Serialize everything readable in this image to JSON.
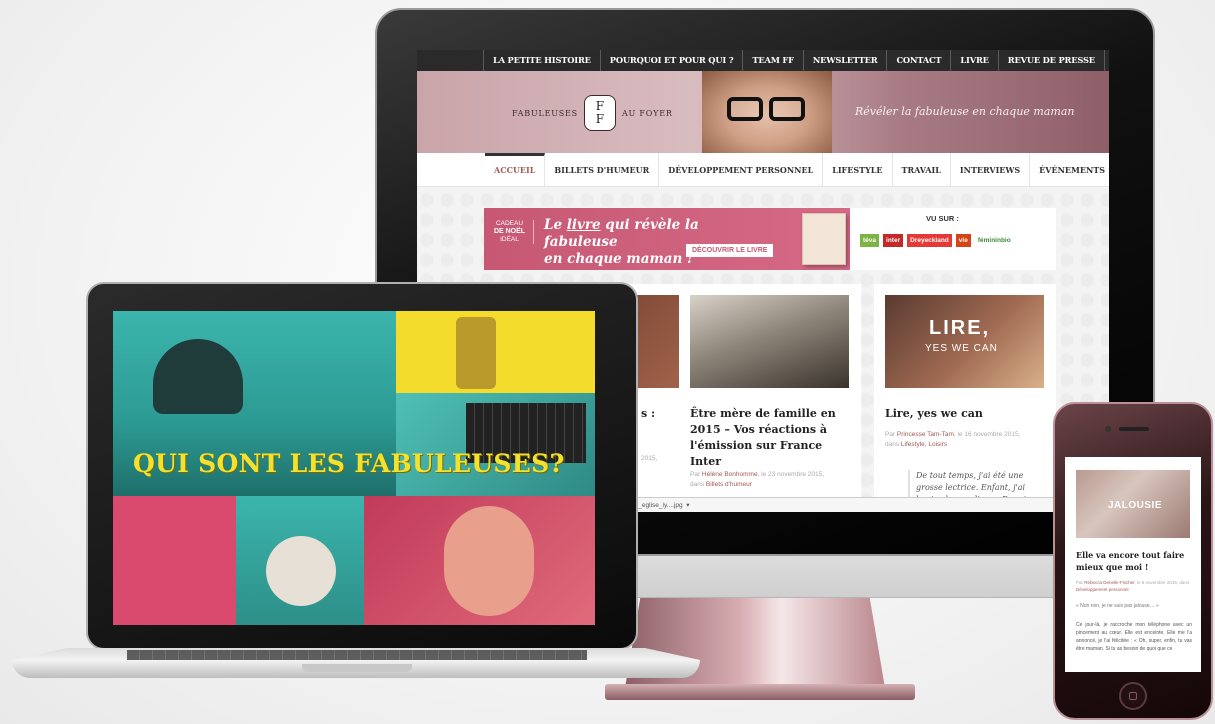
{
  "imac": {
    "topnav": [
      "LA PETITE HISTOIRE",
      "POURQUOI ET POUR QUI ?",
      "TEAM FF",
      "NEWSLETTER",
      "CONTACT",
      "LIVRE",
      "REVUE DE PRESSE"
    ],
    "logo": {
      "left": "FABULEUSES",
      "mark_top": "F",
      "mark_bottom": "F",
      "right": "AU FOYER"
    },
    "tagline": "Révéler la fabuleuse en chaque maman",
    "mainnav": [
      "ACCUEIL",
      "BILLETS D'HUMEUR",
      "DÉVELOPPEMENT PERSONNEL",
      "LIFESTYLE",
      "TRAVAIL",
      "INTERVIEWS",
      "ÉVÉNEMENTS"
    ],
    "banner": {
      "gift_line1": "CADEAU",
      "gift_line2": "DE NOËL",
      "gift_line3": "IDÉAL",
      "title_pre": "Le ",
      "title_underlined": "livre",
      "title_post": " qui révèle la fabuleuse",
      "title_line2": "en chaque maman !",
      "cta": "DÉCOUVRIR LE LIVRE",
      "seen_on": "VU SUR :",
      "media": [
        "téva",
        "inter",
        "Dreyeckland",
        "vie",
        "fémininbio"
      ]
    },
    "cards": [
      {
        "title_fragment": "s :",
        "meta_fragment": "2015,"
      },
      {
        "title": "Être mère de famille en 2015 – Vos réactions à l'émission sur France Inter",
        "meta_by": "Par ",
        "author": "Hélène Bonhomme",
        "meta_date": ", le 23 novembre 2015,",
        "meta_in": "dans ",
        "category": "Billets d'humeur"
      },
      {
        "image_text_line1": "LIRE,",
        "image_text_line2": "YES WE CAN",
        "title": "Lire, yes we can",
        "meta_by": "Par ",
        "author": "Princesse Tam-Tam",
        "meta_date": ", le 16 novembre 2015,",
        "meta_in": "dans ",
        "category": "Lifestyle, Loisirs",
        "quote": "De tout temps, j'ai été une grosse lectrice. Enfant, j'ai lu et relu mes livres. Depuis mes"
      }
    ],
    "status_download": "r_finale_eglise_ly....jpg"
  },
  "laptop": {
    "headline": "QUI SONT LES FABULEUSES?"
  },
  "phone": {
    "image_label": "JALOUSIE",
    "title": "Elle va encore tout faire mieux que moi !",
    "meta_by": "Par ",
    "author": "Rebecca Denelle-Fischer",
    "meta_date": ", le 9 novembre 2015, dans ",
    "category": "Développement personnel",
    "quote": "« Non non, je ne suis pas jalouse… »",
    "body": "Ce jour-là, je raccroche mon téléphone avec un pincement au cœur. Elle est enceinte. Elle me l'a annoncé, je l'ai félicitée : « Oh, super, enfin, tu vas être maman. Si tu as besoin de quoi que ce"
  },
  "colors": {
    "accent": "#a05a55",
    "banner_pink": "#c65873",
    "headline_yellow": "#f3e130",
    "teal": "#3bb5ad",
    "magenta": "#d94a6e"
  }
}
